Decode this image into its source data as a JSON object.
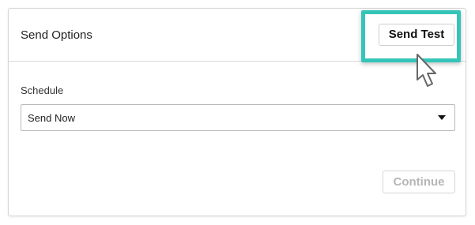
{
  "panel": {
    "title": "Send Options",
    "send_test_label": "Send Test"
  },
  "schedule": {
    "label": "Schedule",
    "selected": "Send Now"
  },
  "footer": {
    "continue_label": "Continue",
    "continue_disabled": true
  },
  "colors": {
    "highlight": "#35c5b8",
    "disabled_text": "#b6b6b6"
  },
  "icons": {
    "cursor": "pointer-cursor-icon",
    "caret": "caret-down-icon"
  }
}
